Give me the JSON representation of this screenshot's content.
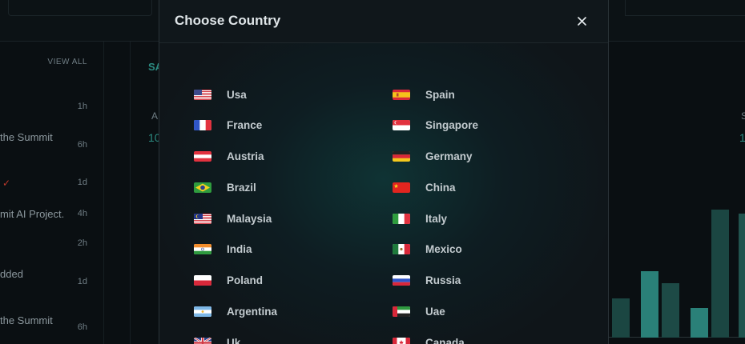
{
  "background": {
    "view_all": "VIEW ALL",
    "activity": [
      {
        "text": "the Summit",
        "time": "1h"
      },
      {
        "text": "",
        "time": "6h"
      },
      {
        "text": "",
        "time": "1d"
      },
      {
        "text": "mit AI Project.",
        "time": "4h"
      },
      {
        "text": "",
        "time": "2h"
      },
      {
        "text": "dded",
        "time": "1d"
      },
      {
        "text": "the Summit",
        "time": "6h"
      }
    ],
    "mid_label": "SA",
    "mid_sub": "A",
    "mid_value": "10",
    "right_sub": "S",
    "right_value": "1",
    "bar_levels": [
      0.29,
      0.49,
      0.4,
      0.22,
      0.94,
      0.91
    ],
    "accent": "#2a7f78",
    "bar_dark": "#1c4a46"
  },
  "modal": {
    "title": "Choose Country",
    "close_icon": "close-icon",
    "countries_left": [
      {
        "name": "Usa",
        "flag": "us"
      },
      {
        "name": "France",
        "flag": "fr"
      },
      {
        "name": "Austria",
        "flag": "at"
      },
      {
        "name": "Brazil",
        "flag": "br"
      },
      {
        "name": "Malaysia",
        "flag": "my"
      },
      {
        "name": "India",
        "flag": "in"
      },
      {
        "name": "Poland",
        "flag": "pl"
      },
      {
        "name": "Argentina",
        "flag": "ar"
      },
      {
        "name": "Uk",
        "flag": "gb"
      }
    ],
    "countries_right": [
      {
        "name": "Spain",
        "flag": "es"
      },
      {
        "name": "Singapore",
        "flag": "sg"
      },
      {
        "name": "Germany",
        "flag": "de"
      },
      {
        "name": "China",
        "flag": "cn"
      },
      {
        "name": "Italy",
        "flag": "it"
      },
      {
        "name": "Mexico",
        "flag": "mx"
      },
      {
        "name": "Russia",
        "flag": "ru"
      },
      {
        "name": "Uae",
        "flag": "ae"
      },
      {
        "name": "Canada",
        "flag": "ca"
      }
    ]
  }
}
